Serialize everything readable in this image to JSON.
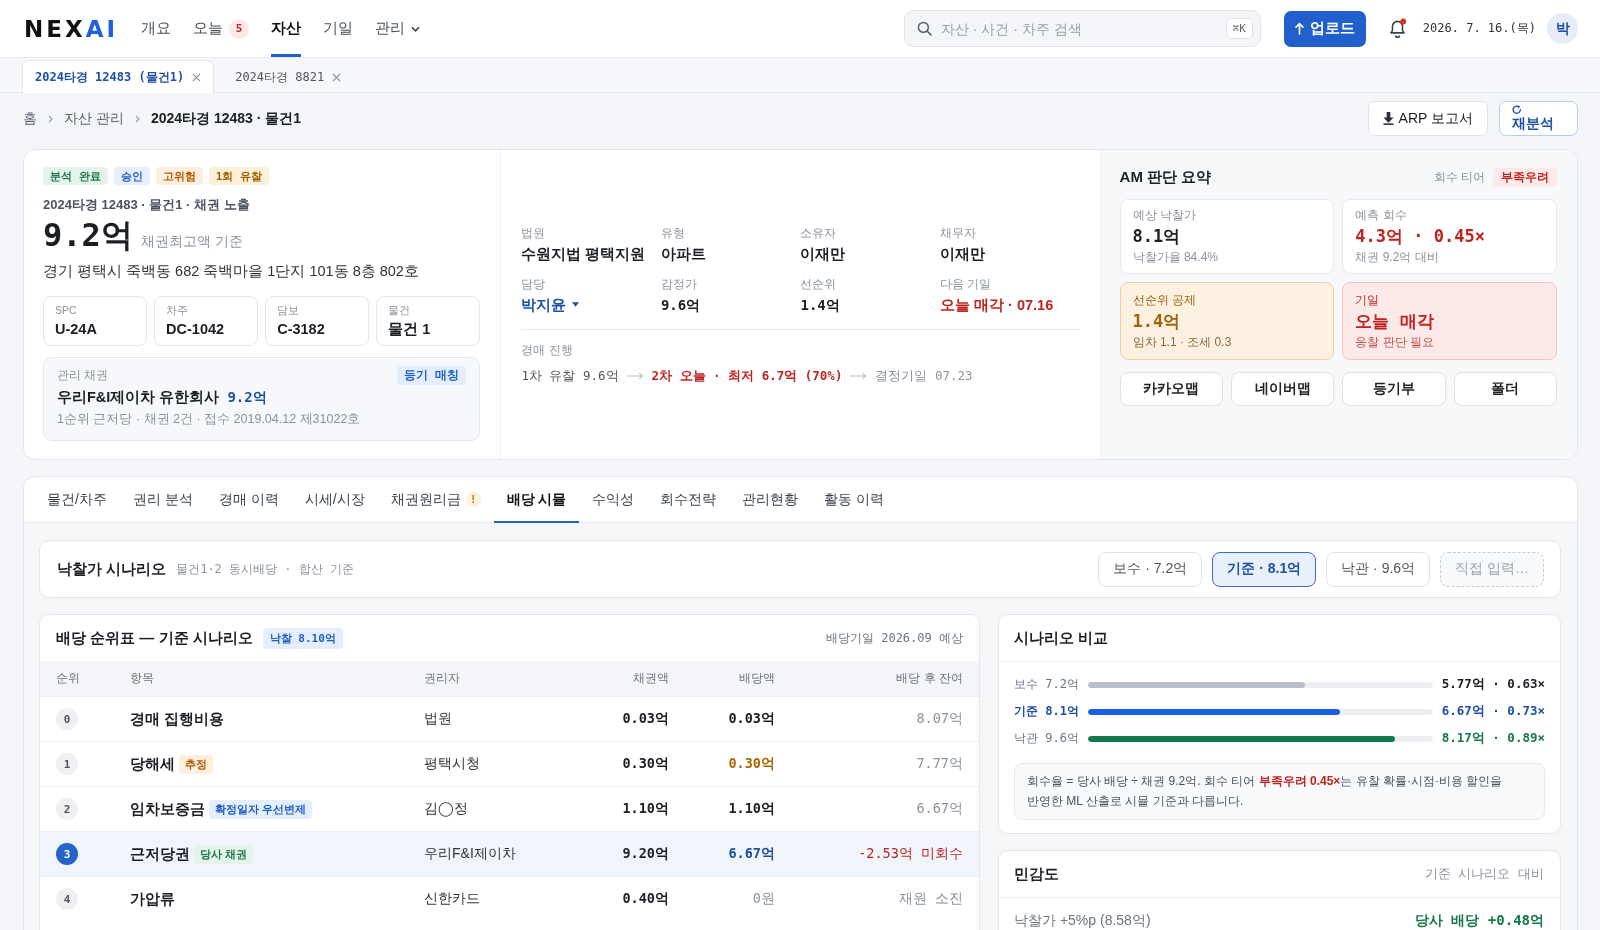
{
  "app_bar": {
    "logo": [
      {
        "text": "NEX",
        "accent": false
      },
      {
        "text": "AI",
        "accent": true
      }
    ],
    "nav": [
      {
        "label": "개요",
        "selected": false,
        "has_menu": false
      },
      {
        "label": "오늘",
        "selected": false,
        "has_menu": false,
        "badge": "5"
      },
      {
        "label": "자산",
        "selected": true,
        "has_menu": false
      },
      {
        "label": "기일",
        "selected": false,
        "has_menu": false
      },
      {
        "label": "관리",
        "selected": false,
        "has_menu": true
      }
    ],
    "search": {
      "placeholder": "자산 · 사건 · 차주 검색",
      "shortcut": "⌘K"
    },
    "upload_button": "업로드",
    "notifications": {
      "unread": true
    },
    "date": "2026. 7. 16.(목)",
    "avatar": "박"
  },
  "document_tabs": [
    {
      "label": "2024타경 12483 (물건1)",
      "selected": true
    },
    {
      "label": "2024타경 8821",
      "selected": false
    }
  ],
  "breadcrumb": [
    "홈",
    "자산 관리",
    "2024타경 12483 · 물건1"
  ],
  "page_actions": [
    {
      "label": "ARP 보고서",
      "kind": "download"
    },
    {
      "label": "재분석",
      "kind": "refresh"
    }
  ],
  "asset": {
    "badges": [
      {
        "label": "분석 완료",
        "kind": "success"
      },
      {
        "label": "승인",
        "kind": "info"
      },
      {
        "label": "고위험",
        "kind": "warning"
      },
      {
        "label": "1회 유찰",
        "kind": "caution"
      }
    ],
    "title": "2024타경 12483 · 물건1 · 채권 노출",
    "amount": "9.2억",
    "amount_note": "채권최고액 기준",
    "address": "경기 평택시 죽백동 682 죽백마을 1단지 101동 8층 802호",
    "ids": [
      {
        "label": "SPC",
        "value": "U-24A"
      },
      {
        "label": "차주",
        "value": "DC-1042"
      },
      {
        "label": "담보",
        "value": "C-3182"
      },
      {
        "label": "물건",
        "value": "물건 1"
      }
    ],
    "managed_bond": {
      "label": "관리 채권",
      "badge": "등기 매칭",
      "name": "우리F&I제이차 유한회사",
      "amount": "9.2억",
      "detail": "1순위 근저당 · 채권 2건 · 접수 2019.04.12 제31022호"
    }
  },
  "case_facts": [
    {
      "label": "법원",
      "value": "수원지법 평택지원",
      "kind": "text"
    },
    {
      "label": "유형",
      "value": "아파트",
      "kind": "text"
    },
    {
      "label": "소유자",
      "value": "이재만",
      "kind": "text"
    },
    {
      "label": "채무자",
      "value": "이재만",
      "kind": "text"
    },
    {
      "label": "담당",
      "value": "박지윤",
      "kind": "select"
    },
    {
      "label": "감정가",
      "value": "9.6억",
      "kind": "amount"
    },
    {
      "label": "선순위",
      "value": "1.4억",
      "kind": "amount"
    },
    {
      "label": "다음 기일",
      "value": "오늘 매각 · 07.16",
      "kind": "alert"
    }
  ],
  "auction_progress": {
    "label": "경매 진행",
    "steps": [
      {
        "text": "1차 유찰 9.6억",
        "kind": "past"
      },
      {
        "text": "2차 오늘 · 최저 6.7억 (70%)",
        "kind": "current"
      },
      {
        "text": "결정기일 07.23",
        "kind": "future"
      }
    ]
  },
  "am_summary": {
    "title": "AM 판단 요약",
    "tier_label": "회수 티어",
    "tier": "부족우려",
    "cards": [
      {
        "label": "예상 낙찰가",
        "value": "8.1억",
        "note": "낙찰가율 84.4%",
        "kind": "plain"
      },
      {
        "label": "예측 회수",
        "value": "4.3억 · 0.45×",
        "note": "채권 9.2억 대비",
        "kind": "alert"
      },
      {
        "label": "선순위 공제",
        "value": "1.4억",
        "note": "임차 1.1 · 조세 0.3",
        "kind": "warning"
      },
      {
        "label": "기일",
        "value": "오늘 매각",
        "note": "응찰 판단 필요",
        "kind": "danger"
      }
    ],
    "links": [
      "카카오맵",
      "네이버맵",
      "등기부",
      "폴더"
    ]
  },
  "detail_tabs": [
    {
      "label": "물건/차주",
      "selected": false
    },
    {
      "label": "권리 분석",
      "selected": false
    },
    {
      "label": "경매 이력",
      "selected": false
    },
    {
      "label": "시세/시장",
      "selected": false
    },
    {
      "label": "채권원리금",
      "selected": false,
      "badge": "!"
    },
    {
      "label": "배당 시뮬",
      "selected": true
    },
    {
      "label": "수익성",
      "selected": false
    },
    {
      "label": "회수전략",
      "selected": false
    },
    {
      "label": "관리현황",
      "selected": false
    },
    {
      "label": "활동 이력",
      "selected": false
    }
  ],
  "bid_scenarios": {
    "title": "낙찰가 시나리오",
    "note": "물건1·2 동시배당 · 합산 기준",
    "options": [
      {
        "label": "보수 · 7.2억",
        "selected": false,
        "kind": "preset"
      },
      {
        "label": "기준 · 8.1억",
        "selected": true,
        "kind": "preset"
      },
      {
        "label": "낙관 · 9.6억",
        "selected": false,
        "kind": "preset"
      },
      {
        "label": "직접 입력…",
        "selected": false,
        "kind": "custom"
      }
    ]
  },
  "distribution": {
    "title": "배당 순위표 — 기준 시나리오",
    "badge": "낙찰 8.10억",
    "date_note": "배당기일 2026.09 예상",
    "columns": [
      "순위",
      "항목",
      "권리자",
      "채권액",
      "배당액",
      "배당 후 잔여"
    ],
    "rows": [
      {
        "rank": "0",
        "item": "경매 집행비용",
        "holder": "법원",
        "claim": "0.03억",
        "payout": {
          "text": "0.03억",
          "kind": "normal"
        },
        "remaining": {
          "text": "8.07억",
          "kind": "muted"
        },
        "highlighted": false
      },
      {
        "rank": "1",
        "item": "당해세",
        "tag": {
          "label": "추정",
          "kind": "warning"
        },
        "holder": "평택시청",
        "claim": "0.30억",
        "payout": {
          "text": "0.30억",
          "kind": "warning"
        },
        "remaining": {
          "text": "7.77억",
          "kind": "muted"
        },
        "highlighted": false
      },
      {
        "rank": "2",
        "item": "임차보증금",
        "tag": {
          "label": "확정일자 우선변제",
          "kind": "info"
        },
        "holder": "김◯정",
        "claim": "1.10억",
        "payout": {
          "text": "1.10억",
          "kind": "normal"
        },
        "remaining": {
          "text": "6.67억",
          "kind": "muted"
        },
        "highlighted": false
      },
      {
        "rank": "3",
        "item": "근저당권",
        "tag": {
          "label": "당사 채권",
          "kind": "success"
        },
        "holder": "우리F&I제이차",
        "claim": "9.20억",
        "payout": {
          "text": "6.67억",
          "kind": "accent"
        },
        "remaining": {
          "text": "-2.53억 미회수",
          "kind": "danger"
        },
        "highlighted": true
      },
      {
        "rank": "4",
        "item": "가압류",
        "holder": "신한카드",
        "claim": "0.40억",
        "payout": {
          "text": "0원",
          "kind": "muted"
        },
        "remaining": {
          "text": "재원 소진",
          "kind": "muted"
        },
        "highlighted": false
      }
    ]
  },
  "scenario_compare": {
    "title": "시나리오 비교",
    "rows": [
      {
        "label": "보수 7.2억",
        "current": false,
        "level": 0.63,
        "color": "#b9c0ca",
        "value": "5.77억 · 0.63×",
        "kind": "normal"
      },
      {
        "label": "기준 8.1억",
        "current": true,
        "level": 0.73,
        "color": "#1a5fe0",
        "value": "6.67억 · 0.73×",
        "kind": "accent"
      },
      {
        "label": "낙관 9.6억",
        "current": false,
        "level": 0.89,
        "color": "#137a4c",
        "value": "8.17억 · 0.89×",
        "kind": "positive"
      }
    ],
    "note": "회수율 = 당사 배당 ÷ 채권 9.2억. 회수 티어 **부족우려 0.45×**는 유찰 확률·시점·비용 할인을 반영한 ML 산출로 시뮬 기준과 다릅니다."
  },
  "sensitivity": {
    "title": "민감도",
    "note": "기준 시나리오 대비",
    "rows": [
      {
        "label": "낙찰가 +5%p (8.58억)",
        "value": "당사 배당 +0.48억",
        "kind": "positive"
      }
    ]
  }
}
